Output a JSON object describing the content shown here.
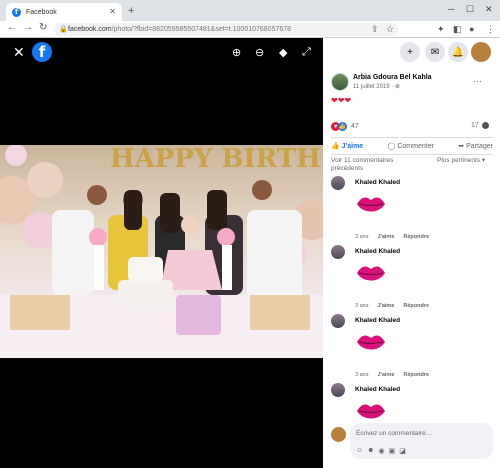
{
  "browser": {
    "tab_title": "Facebook",
    "url_base": "facebook.com",
    "url_rest": "/photo/?fbid=882059585507481&set=t.100010768057678"
  },
  "viewer": {
    "logo_letter": "f"
  },
  "post": {
    "author": "Arbia Gdoura Bel Kahla",
    "date": "11 juillet 2019 · ⊕",
    "hearts": "❤❤❤",
    "reaction_count": "47",
    "comment_count": "17",
    "like_label": "J'aime",
    "comment_label": "Commenter",
    "share_label": "Partager",
    "previous_comments": "Voir 11 commentaires précédents",
    "sort_label": "Plus pertinents"
  },
  "comments": [
    {
      "author": "Khaled Khaled",
      "time": "3 ans",
      "like": "J'aime",
      "reply": "Répondre"
    },
    {
      "author": "Khaled Khaled",
      "time": "3 ans",
      "like": "J'aime",
      "reply": "Répondre"
    },
    {
      "author": "Khaled Khaled",
      "time": "3 ans",
      "like": "J'aime",
      "reply": "Répondre"
    },
    {
      "author": "Khaled Khaled",
      "time": "",
      "like": "",
      "reply": ""
    }
  ],
  "composer": {
    "placeholder": "Écrivez un commentaire…"
  },
  "photo": {
    "balloon_text": "HAPPY BIRTH"
  },
  "colors": {
    "facebook_blue": "#1877f2",
    "heart_red": "#e41e3f"
  }
}
